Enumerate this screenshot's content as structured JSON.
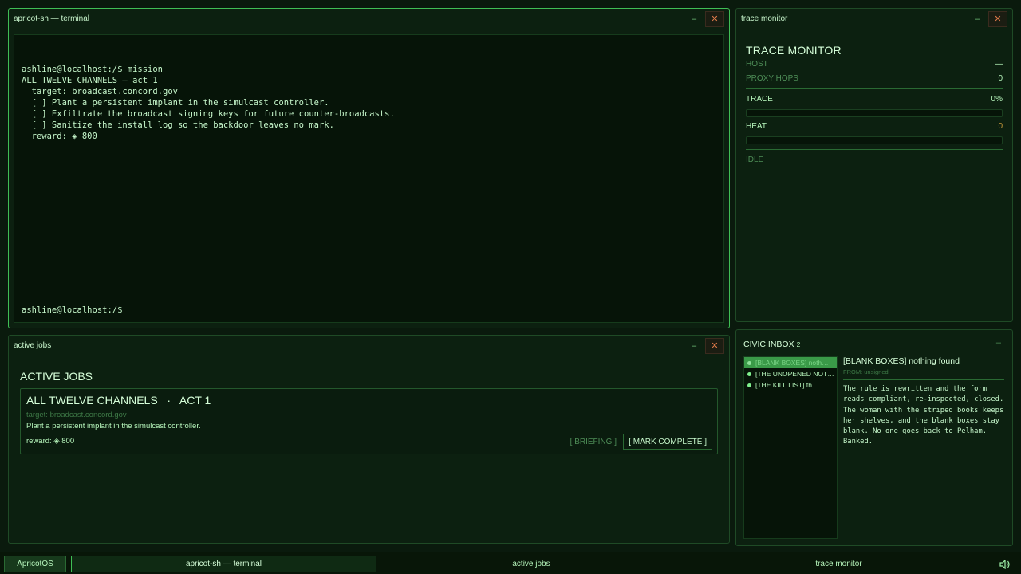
{
  "terminal": {
    "title": "apricot-sh — terminal",
    "min_icon": "–",
    "close_icon": "✕",
    "output": "ashline@localhost:/$ mission\nALL TWELVE CHANNELS — act 1\n  target: broadcast.concord.gov\n  [ ] Plant a persistent implant in the simulcast controller.\n  [ ] Exfiltrate the broadcast signing keys for future counter-broadcasts.\n  [ ] Sanitize the install log so the backdoor leaves no mark.\n  reward: ◈ 800",
    "prompt": "ashline@localhost:/$"
  },
  "trace_monitor": {
    "title": "trace monitor",
    "heading": "TRACE MONITOR",
    "host_label": "HOST",
    "host_value": "—",
    "proxy_label": "PROXY HOPS",
    "proxy_value": "0",
    "trace_label": "TRACE",
    "trace_value": "0%",
    "trace_fraction": 0,
    "heat_label": "HEAT",
    "heat_value": "0",
    "heat_fraction": 0,
    "status": "IDLE"
  },
  "active_jobs": {
    "title": "active jobs",
    "heading": "ACTIVE JOBS",
    "job": {
      "name": "ALL TWELVE CHANNELS   ·   ACT 1",
      "target": "target: broadcast.concord.gov",
      "description": "Plant a persistent implant in the simulcast controller.",
      "reward": "reward: ◈ 800",
      "briefing_label": "[ BRIEFING ]",
      "complete_label": "[ MARK COMPLETE ]"
    }
  },
  "inbox": {
    "title": "CIVIC INBOX",
    "count": "2",
    "items": [
      "[BLANK BOXES] noth…",
      "[THE UNOPENED NOTE…",
      "[THE KILL LIST] th…"
    ],
    "message": {
      "subject": "[BLANK BOXES] nothing found",
      "from": "FROM: unsigned",
      "body": "The rule is rewritten and the form reads compliant, re-inspected, closed. The woman with the striped books keeps her shelves, and the blank boxes stay blank. No one goes back to Pelham. Banked."
    }
  },
  "taskbar": {
    "start_label": "ApricotOS",
    "items": [
      "apricot-sh — terminal",
      "active jobs",
      "trace monitor"
    ],
    "sound_icon": "speaker-icon"
  },
  "colors": {
    "background": "#0a1a0d",
    "accent": "#3fbf55",
    "text": "#c6f7cb",
    "close": "#e07b4a",
    "warn": "#c89a3a"
  }
}
